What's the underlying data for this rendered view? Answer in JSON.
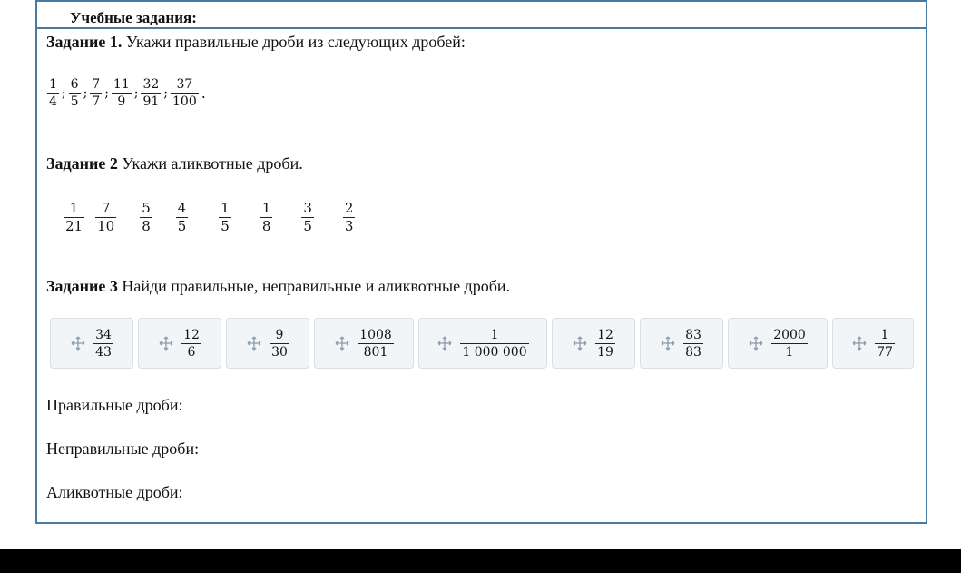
{
  "header": {
    "title": "Учебные задания:"
  },
  "task1": {
    "label": "Задание 1.",
    "text": " Укажи правильные дроби из следующих дробей:",
    "fractions": [
      {
        "num": "1",
        "den": "4"
      },
      {
        "num": "6",
        "den": "5"
      },
      {
        "num": "7",
        "den": "7"
      },
      {
        "num": "11",
        "den": "9"
      },
      {
        "num": "32",
        "den": "91"
      },
      {
        "num": "37",
        "den": "100"
      }
    ],
    "separator": ";",
    "end": "."
  },
  "task2": {
    "label": "Задание 2",
    "text": " Укажи аликвотные дроби.",
    "fractions": [
      {
        "num": "1",
        "den": "21"
      },
      {
        "num": "7",
        "den": "10"
      },
      {
        "num": "5",
        "den": "8"
      },
      {
        "num": "4",
        "den": "5"
      },
      {
        "num": "1",
        "den": "5"
      },
      {
        "num": "1",
        "den": "8"
      },
      {
        "num": "3",
        "den": "5"
      },
      {
        "num": "2",
        "den": "3"
      }
    ]
  },
  "task3": {
    "label": "Задание 3",
    "text": " Найди правильные, неправильные и аликвотные дроби.",
    "cards": [
      {
        "num": "34",
        "den": "43"
      },
      {
        "num": "12",
        "den": "6"
      },
      {
        "num": "9",
        "den": "30"
      },
      {
        "num": "1008",
        "den": "801"
      },
      {
        "num": "1",
        "den": "1 000 000"
      },
      {
        "num": "12",
        "den": "19"
      },
      {
        "num": "83",
        "den": "83"
      },
      {
        "num": "2000",
        "den": "1"
      },
      {
        "num": "1",
        "den": "77"
      }
    ],
    "move_icon": "move-arrows-icon"
  },
  "answers": {
    "proper": "Правильные дроби:",
    "improper": "Неправильные дроби:",
    "aliquot": "Аликвотные дроби:"
  },
  "colors": {
    "frame": "#4a7aa0",
    "chip_bg": "#f2f5f8",
    "chip_border": "#d9dfe6"
  }
}
